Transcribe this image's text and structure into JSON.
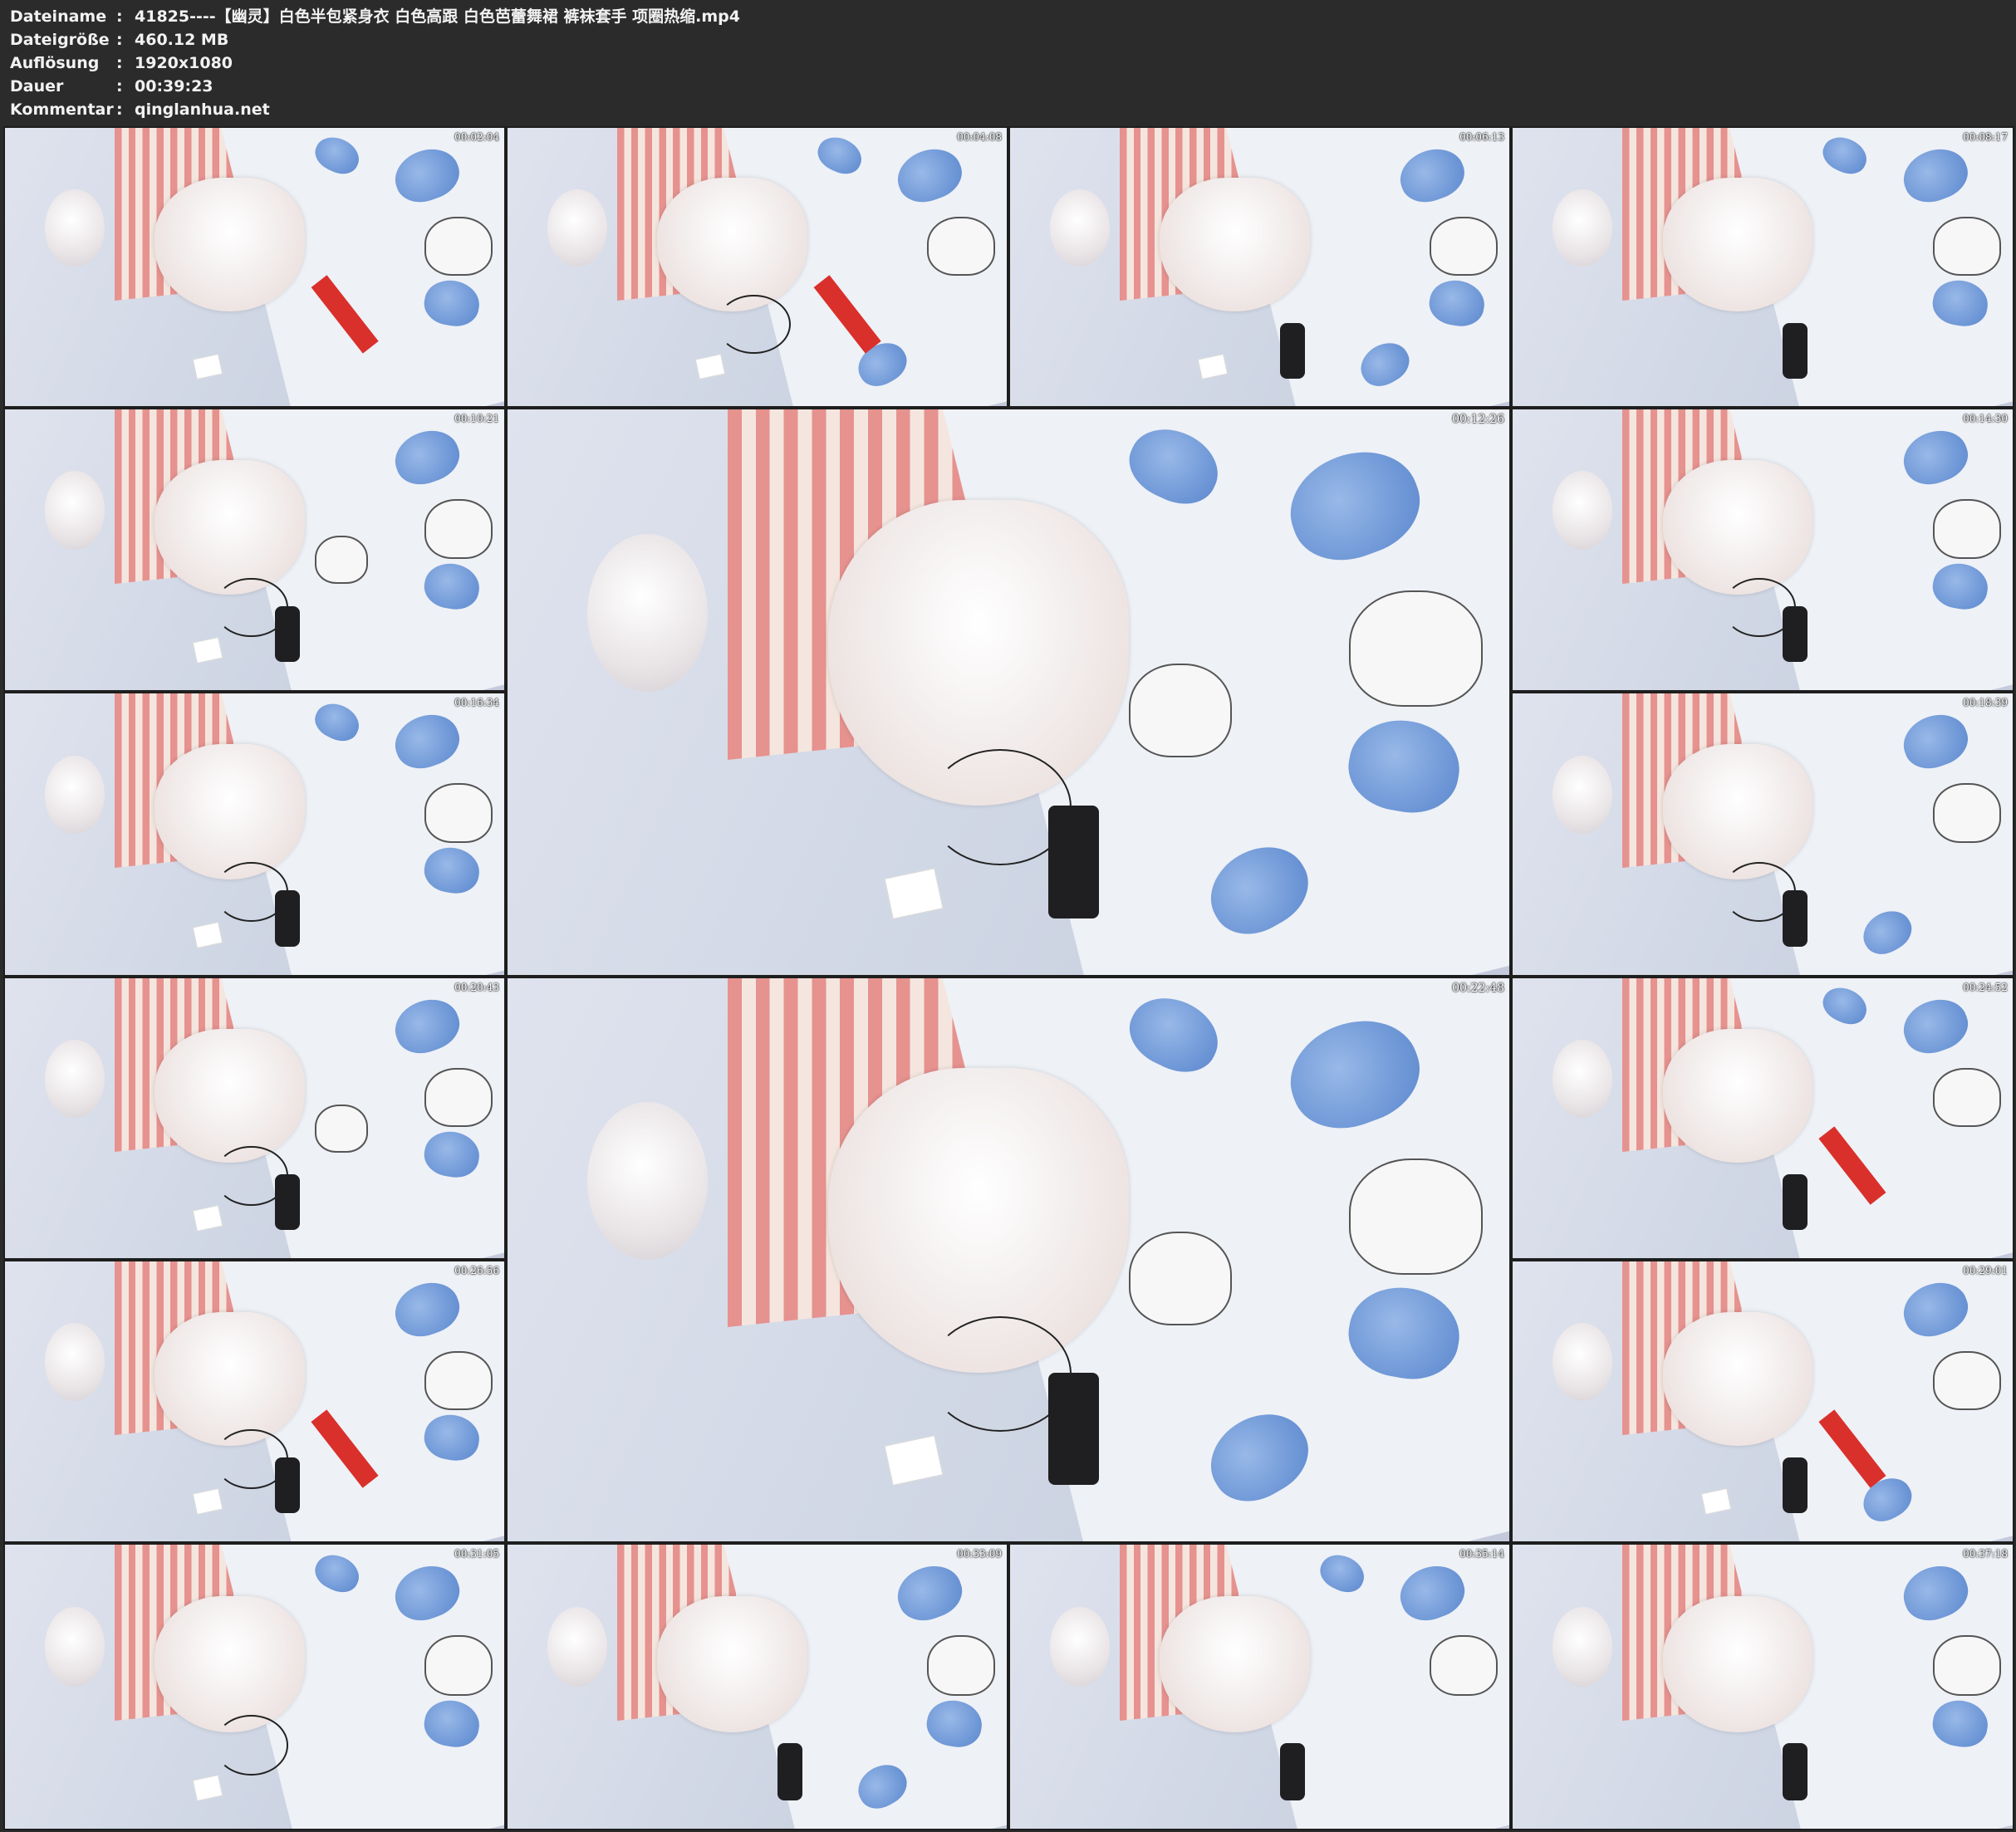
{
  "info": [
    {
      "key": "Dateiname",
      "value": "41825----【幽灵】白色半包紧身衣 白色高跟 白色芭蕾舞裙 裤袜套手 项圈热缩.mp4"
    },
    {
      "key": "Dateigröße",
      "value": "460.12 MB"
    },
    {
      "key": "Auflösung",
      "value": "1920x1080"
    },
    {
      "key": "Dauer",
      "value": "00:39:23"
    },
    {
      "key": "Kommentar",
      "value": "qinglanhua.net"
    }
  ],
  "separator": ":",
  "thumbnails": [
    {
      "timestamp": "00:02:04"
    },
    {
      "timestamp": "00:04:08"
    },
    {
      "timestamp": "00:06:13"
    },
    {
      "timestamp": "00:08:17"
    },
    {
      "timestamp": "00:10:21"
    },
    {
      "timestamp": "00:12:26"
    },
    {
      "timestamp": "00:14:30"
    },
    {
      "timestamp": "00:16:34"
    },
    {
      "timestamp": "00:18:39"
    },
    {
      "timestamp": "00:20:43"
    },
    {
      "timestamp": "00:22:48"
    },
    {
      "timestamp": "00:24:52"
    },
    {
      "timestamp": "00:26:56"
    },
    {
      "timestamp": "00:29:01"
    },
    {
      "timestamp": "00:31:05"
    },
    {
      "timestamp": "00:33:09"
    },
    {
      "timestamp": "00:35:14"
    },
    {
      "timestamp": "00:37:18"
    }
  ]
}
